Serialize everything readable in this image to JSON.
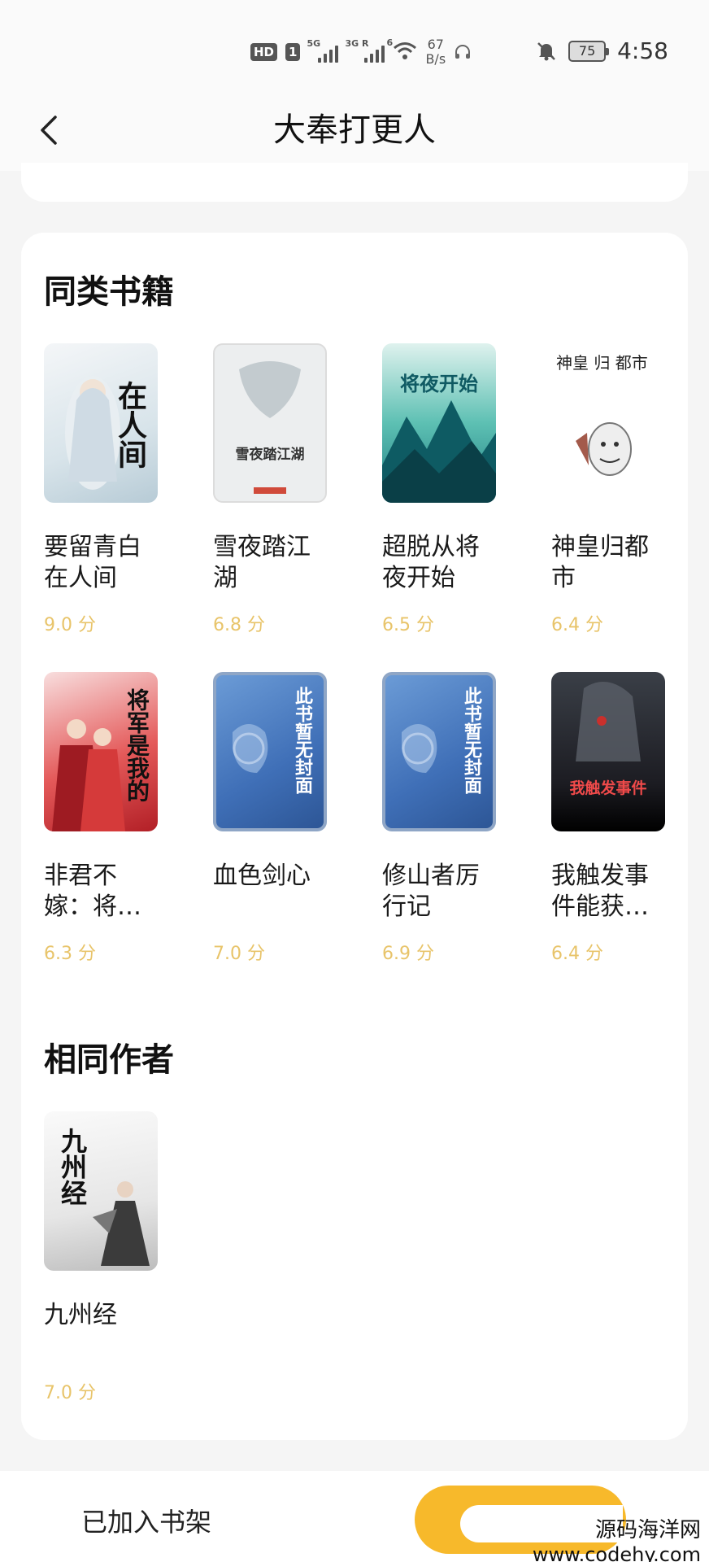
{
  "status_bar": {
    "hd": "HD",
    "sim": "1",
    "signal1_label": "5G",
    "signal2_label": "3G R",
    "wifi_label": "6",
    "speed_value": "67",
    "speed_unit": "B/s",
    "battery": "75",
    "time": "4:58"
  },
  "header": {
    "title": "大奉打更人"
  },
  "similar": {
    "title": "同类书籍",
    "books": [
      {
        "name": "要留青白在人间",
        "score": "9.0 分",
        "cover_text": "在人间",
        "cover_bg": "#eef2f4"
      },
      {
        "name": "雪夜踏江湖",
        "score": "6.8 分",
        "cover_text": "雪夜踏江湖",
        "cover_bg": "#eceeef"
      },
      {
        "name": "超脱从将夜开始",
        "score": "6.5 分",
        "cover_text": "将夜开始",
        "cover_bg": "#3fb0a8"
      },
      {
        "name": "神皇归都市",
        "score": "6.4 分",
        "cover_text": "神皇 归 都市",
        "cover_bg": "#ffffff"
      },
      {
        "name": "非君不嫁：将…",
        "score": "6.3 分",
        "cover_text": "将军是我的",
        "cover_bg": "#c83a3a"
      },
      {
        "name": "血色剑心",
        "score": "7.0 分",
        "cover_text": "此书暂无封面",
        "cover_bg": "#3f6fb7"
      },
      {
        "name": "修山者厉行记",
        "score": "6.9 分",
        "cover_text": "此书暂无封面",
        "cover_bg": "#3f6fb7"
      },
      {
        "name": "我触发事件能获…",
        "score": "6.4 分",
        "cover_text": "我触发事件",
        "cover_bg": "#1c1c22"
      }
    ]
  },
  "same_author": {
    "title": "相同作者",
    "books": [
      {
        "name": "九州经",
        "score": "7.0 分",
        "cover_text": "九州经",
        "cover_bg": "#f0f0f0"
      }
    ]
  },
  "bottom": {
    "shelf_label": "已加入书架"
  },
  "watermark": {
    "line1": "源码海洋网",
    "line2": "www.codehy.com"
  },
  "colors": {
    "accent": "#f7b92b",
    "score": "#e8c46a"
  }
}
